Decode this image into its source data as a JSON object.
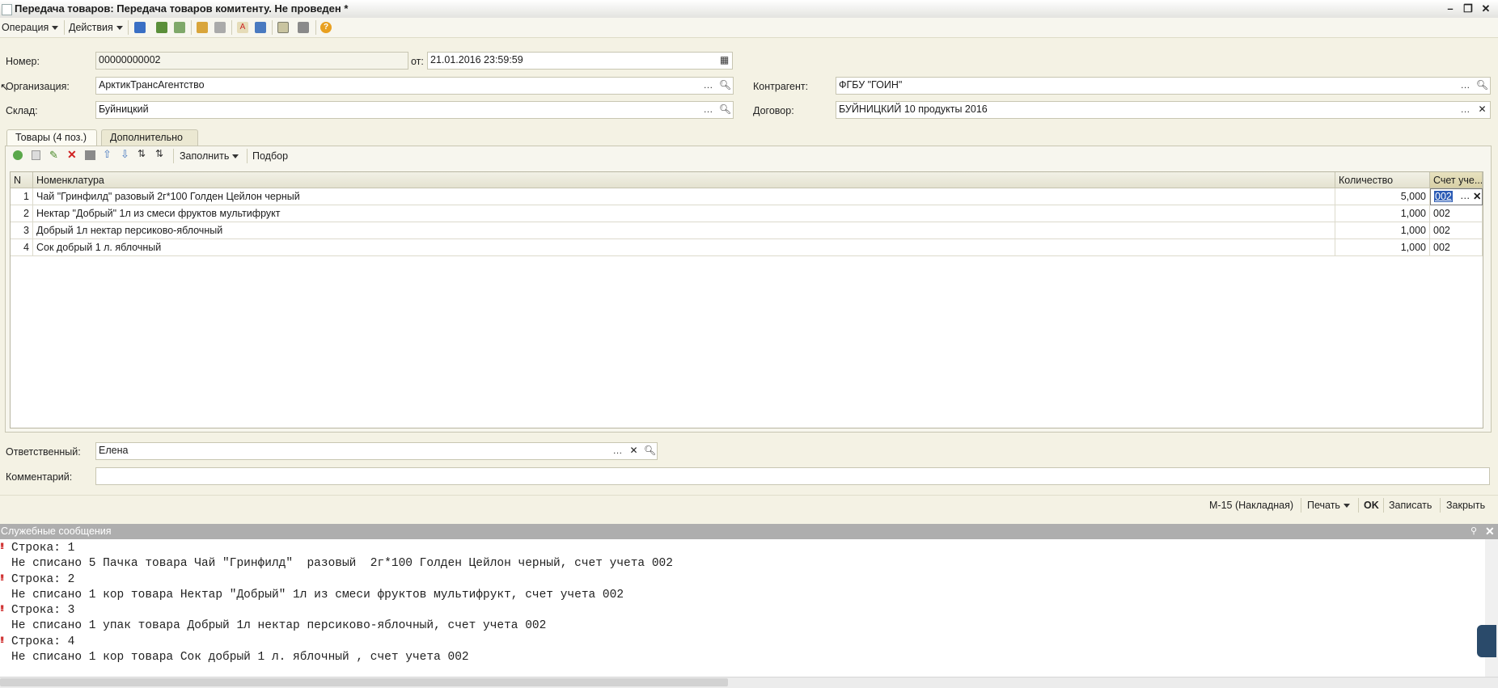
{
  "window": {
    "title": "Передача товаров: Передача товаров комитенту. Не проведен *"
  },
  "toolbar": {
    "operation": "Операция",
    "actions": "Действия"
  },
  "header": {
    "number_label": "Номер:",
    "number_value": "00000000002",
    "date_label": "от:",
    "date_value": "21.01.2016 23:59:59",
    "org_label": "Организация:",
    "org_value": "АрктикТрансАгентство",
    "warehouse_label": "Склад:",
    "warehouse_value": "Буйницкий",
    "counterparty_label": "Контрагент:",
    "counterparty_value": "ФГБУ \"ГОИН\"",
    "contract_label": "Договор:",
    "contract_value": "БУЙНИЦКИЙ 10 продукты 2016"
  },
  "tabs": [
    {
      "label": "Товары (4 поз.)"
    },
    {
      "label": "Дополнительно"
    }
  ],
  "table_toolbar": {
    "fill": "Заполнить",
    "pick": "Подбор"
  },
  "table": {
    "columns": [
      "N",
      "Номенклатура",
      "Количество",
      "Счет уче..."
    ],
    "rows": [
      {
        "n": "1",
        "name": "Чай \"Гринфилд\"  разовый  2г*100 Голден Цейлон черный",
        "qty": "5,000",
        "account": "002"
      },
      {
        "n": "2",
        "name": "Нектар \"Добрый\" 1л из смеси фруктов мультифрукт",
        "qty": "1,000",
        "account": "002"
      },
      {
        "n": "3",
        "name": "Добрый 1л нектар персиково-яблочный",
        "qty": "1,000",
        "account": "002"
      },
      {
        "n": "4",
        "name": "Сок добрый 1 л. яблочный",
        "qty": "1,000",
        "account": "002"
      }
    ]
  },
  "footer": {
    "responsible_label": "Ответственный:",
    "responsible_value": "Елена",
    "comment_label": "Комментарий:",
    "comment_value": ""
  },
  "bottom_bar": {
    "form_m15": "М-15 (Накладная)",
    "print": "Печать",
    "ok": "OK",
    "save": "Записать",
    "close": "Закрыть"
  },
  "messages": {
    "title": "Служебные сообщения",
    "lines": [
      {
        "mark": "!!",
        "text": "Строка: 1"
      },
      {
        "mark": "",
        "text": "Не списано 5 Пачка товара Чай \"Гринфилд\"  разовый  2г*100 Голден Цейлон черный, счет учета 002"
      },
      {
        "mark": "!!",
        "text": "Строка: 2"
      },
      {
        "mark": "",
        "text": "Не списано 1 кор товара Нектар \"Добрый\" 1л из смеси фруктов мультифрукт, счет учета 002"
      },
      {
        "mark": "!!",
        "text": "Строка: 3"
      },
      {
        "mark": "",
        "text": "Не списано 1 упак товара Добрый 1л нектар персиково-яблочный, счет учета 002"
      },
      {
        "mark": "!!",
        "text": "Строка: 4"
      },
      {
        "mark": "",
        "text": "Не списано 1 кор товара Сок добрый 1 л. яблочный , счет учета 002"
      }
    ]
  }
}
